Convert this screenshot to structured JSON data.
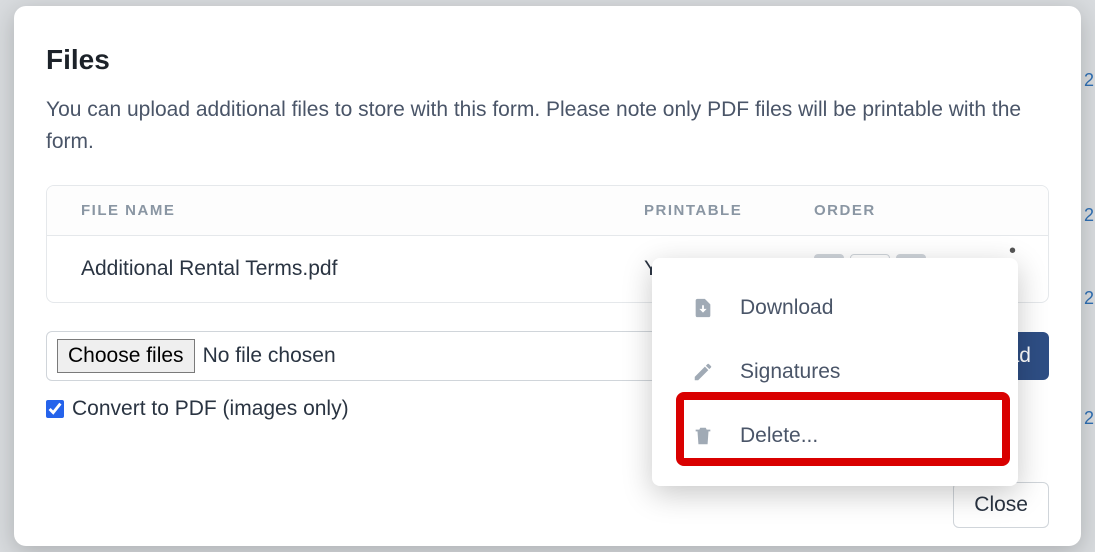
{
  "modal": {
    "title": "Files",
    "description": "You can upload additional files to store with this form. Please note only PDF files will be printable with the form."
  },
  "table": {
    "headers": {
      "name": "FILE NAME",
      "printable": "PRINTABLE",
      "order": "ORDER"
    },
    "rows": [
      {
        "name": "Additional Rental Terms.pdf",
        "printable": "Yes"
      }
    ]
  },
  "upload": {
    "choose_label": "Choose files",
    "no_file_text": "No file chosen",
    "upload_label": "Upload"
  },
  "convert": {
    "checked": true,
    "label": "Convert to PDF (images only)"
  },
  "menu": {
    "download": "Download",
    "signatures": "Signatures",
    "delete": "Delete..."
  },
  "footer": {
    "close_label": "Close"
  },
  "background": {
    "edge_char": "2"
  }
}
